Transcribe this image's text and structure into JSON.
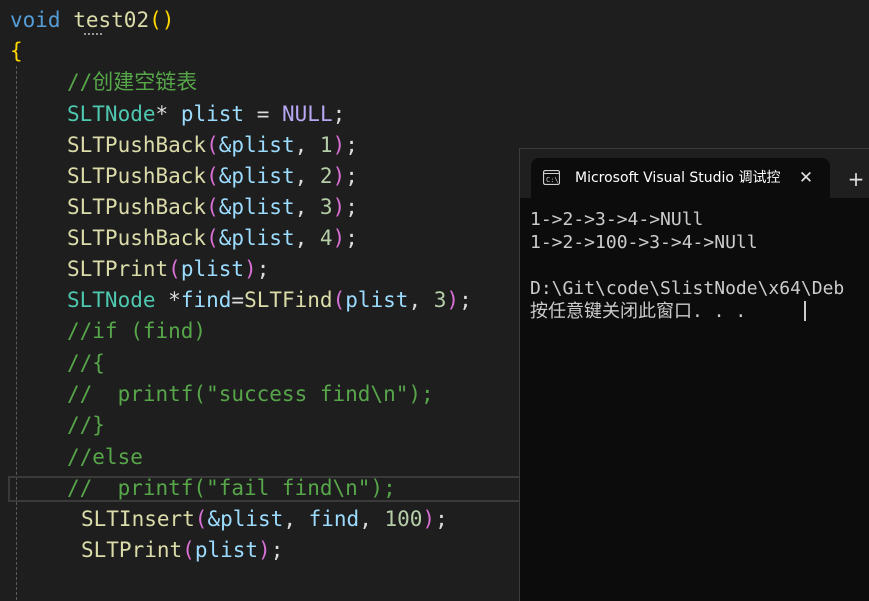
{
  "editor": {
    "line1": {
      "kw": "void",
      "fn": "test02",
      "open": "(",
      "close": ")"
    },
    "line2": {
      "brace": "{"
    },
    "line3": {
      "comment": "//创建空链表"
    },
    "line4": {
      "type": "SLTNode",
      "star": "*",
      "var": "plist",
      "eq": "=",
      "null": "NULL",
      "semi": ";"
    },
    "pushback_fn": "SLTPushBack",
    "pushback_args": [
      {
        "ref": "&plist",
        "sep": ", ",
        "num": "1"
      },
      {
        "ref": "&plist",
        "sep": ", ",
        "num": "2"
      },
      {
        "ref": "&plist",
        "sep": ", ",
        "num": "3"
      },
      {
        "ref": "&plist",
        "sep": ", ",
        "num": "4"
      }
    ],
    "print_line": {
      "fn": "SLTPrint",
      "arg": "plist"
    },
    "find_line": {
      "type": "SLTNode",
      "star": "*",
      "var": "find",
      "eq": "=",
      "fn": "SLTFind",
      "arg": "plist",
      "sep": ", ",
      "num": "3"
    },
    "comments": [
      "//if (find)",
      "//{",
      "//  printf(\"success find\\n\");",
      "//}",
      "//else",
      "//  printf(\"fail find\\n\");"
    ],
    "insert_line": {
      "fn": "SLTInsert",
      "ref": "&plist",
      "sep1": ", ",
      "var": "find",
      "sep2": ", ",
      "num": "100"
    },
    "print_line2": {
      "fn": "SLTPrint",
      "arg": "plist"
    },
    "punct": {
      "open": "(",
      "close": ")",
      "semi": ";"
    }
  },
  "console": {
    "tab_title": "Microsoft Visual Studio 调试控",
    "close_glyph": "✕",
    "new_tab_glyph": "+",
    "output": [
      "1->2->3->4->NUll",
      "1->2->100->3->4->NUll",
      "",
      "D:\\Git\\code\\SlistNode\\x64\\Deb",
      "按任意键关闭此窗口. . ."
    ]
  },
  "colors": {
    "background": "#1e1e1e",
    "keyword": "#569cd6",
    "function": "#dcdcaa",
    "type": "#4ec9b0",
    "variable": "#9cdcfe",
    "number": "#b5cea8",
    "comment": "#57a64a",
    "console_bg": "#0c0c0c"
  }
}
